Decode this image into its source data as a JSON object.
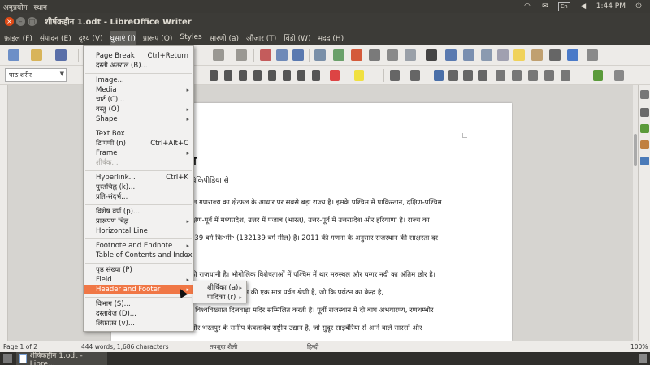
{
  "top_panel": {
    "left_items": [
      "अनुप्रयोग",
      "स्थान"
    ],
    "keyboard_layout": "En",
    "time": "1:44 PM",
    "icons": [
      "wifi-icon",
      "mail-icon",
      "volume-icon",
      "power-icon"
    ]
  },
  "window": {
    "title": "शीर्षकहीन 1.odt - LibreOffice Writer"
  },
  "menu_bar": {
    "items": [
      {
        "label": "फ़ाइल (F)"
      },
      {
        "label": "संपादन (E)"
      },
      {
        "label": "दृश्य (V)"
      },
      {
        "label": "घुसाएं (I)"
      },
      {
        "label": "प्रारूप (O)"
      },
      {
        "label": "Styles"
      },
      {
        "label": "सारणी (a)"
      },
      {
        "label": "औज़ार (T)"
      },
      {
        "label": "विंडो (W)"
      },
      {
        "label": "मदद (H)"
      }
    ],
    "active_index": 3
  },
  "toolbar": {
    "paragraph_style": "पाठ शरीर"
  },
  "document": {
    "title": "न",
    "subtitle": "विकिपीडिया से",
    "lines": [
      "रत गणराज्य का क्षेत्फल के आधार पर सबसे बड़ा राज्य है। इसके पश्चिम में पाकिस्तान, दक्षिण-पश्चिम",
      "क्षिण-पूर्व में मध्यप्रदेश, उत्तर में पंजाब (भारत), उत्तर-पूर्व में उत्तरप्रदेश और हरियाणा है। राज्य का",
      "239 वर्ग कि॰मी॰ (132139 वर्ग मील) है। 2011 की गणना के अनुसार राजस्थान की साक्षरता दर",
      "की राजधानी है। भौगोलिक विशेषताओं में पश्चिम में थार मरुस्थल और घग्गर नदी का अंतिम छोर है।",
      "अरावली श्रेणी राजस्थान की एक मात्र पर्वत श्रेणी है, जो कि पर्यटन का केन्द्र है,",
      "र विश्वविख्यात दिलवाड़ा मंदिर सम्मिलित करती है। पूर्वी राजस्थान में दो बाघ अभयारण्य, रणथम्भौर",
      "और भरतपुर के समीप केवलादेव राष्ट्रीय उद्यान है, जो सुदूर साइबेरिया से आने वाले सारसों और"
    ]
  },
  "insert_menu": {
    "items": [
      {
        "label": "Page Break",
        "shortcut": "Ctrl+Return"
      },
      {
        "label": "दस्ती अंतराल (B)..."
      },
      {
        "separator": true
      },
      {
        "label": "Image..."
      },
      {
        "label": "Media",
        "submenu": true
      },
      {
        "label": "चार्ट (C)..."
      },
      {
        "label": "वस्तु (O)",
        "submenu": true
      },
      {
        "label": "Shape",
        "submenu": true
      },
      {
        "separator": true
      },
      {
        "label": "Text Box"
      },
      {
        "label": "टिप्पणी (n)",
        "shortcut": "Ctrl+Alt+C"
      },
      {
        "label": "Frame",
        "submenu": true
      },
      {
        "label": "शीर्षक...",
        "disabled": true
      },
      {
        "separator": true
      },
      {
        "label": "Hyperlink...",
        "shortcut": "Ctrl+K"
      },
      {
        "label": "पुस्तचिह्न (k)..."
      },
      {
        "label": "प्रति-संदर्भ..."
      },
      {
        "separator": true
      },
      {
        "label": "विशेष वर्ण (p)..."
      },
      {
        "label": "प्रारूपण चिह्न",
        "submenu": true
      },
      {
        "label": "Horizontal Line"
      },
      {
        "separator": true
      },
      {
        "label": "Footnote and Endnote",
        "submenu": true
      },
      {
        "label": "Table of Contents and Index",
        "submenu": true
      },
      {
        "separator": true
      },
      {
        "label": "पृष्ठ संख्या (P)"
      },
      {
        "label": "Field",
        "submenu": true
      },
      {
        "label": "Header and Footer",
        "submenu": true,
        "highlighted": true
      },
      {
        "separator": true
      },
      {
        "label": "विभाग (S)..."
      },
      {
        "label": "दस्तावेज़ (D)..."
      },
      {
        "label": "लिफ़ाफ़ा (v)..."
      }
    ]
  },
  "header_footer_submenu": {
    "items": [
      {
        "label": "शीर्षिका (a)"
      },
      {
        "label": "पादिका (r)"
      }
    ]
  },
  "status_bar": {
    "page": "Page 1 of 2",
    "word_count": "444 words, 1,686 characters",
    "page_style": "तयशुदा शैली",
    "language": "हिन्दी",
    "zoom": "100%"
  },
  "taskbar": {
    "task_label": "शीर्षकहीन 1.odt - Libre..."
  },
  "colors": {
    "menu_highlight": "#f07746",
    "panel": "#3c3b37",
    "close_button": "#df4a16"
  }
}
